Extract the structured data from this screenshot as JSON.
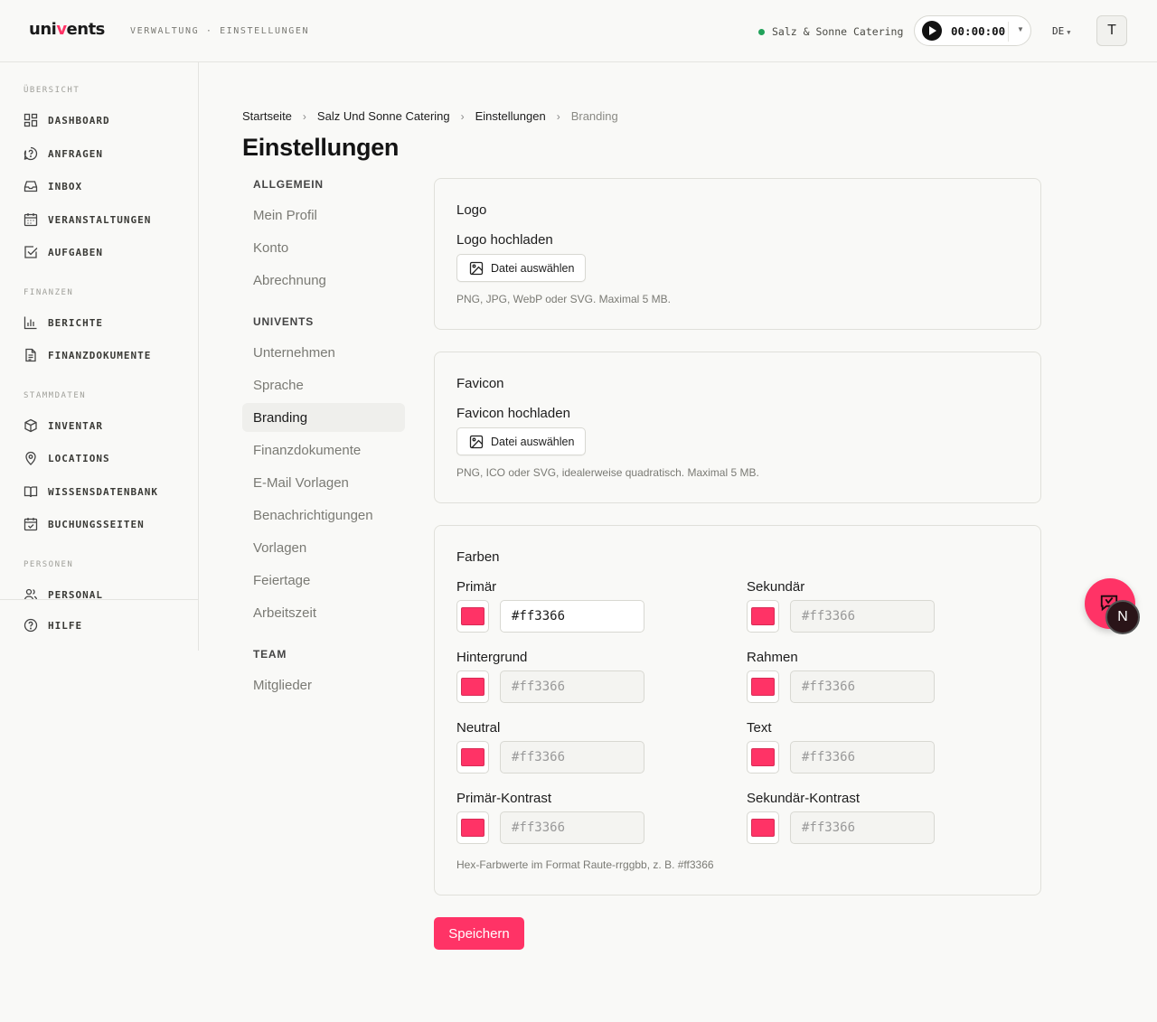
{
  "header": {
    "logo_text_pre": "uni",
    "logo_text_accent": "v",
    "logo_text_post": "ents",
    "breadcrumb": "VERWALTUNG · EINSTELLUNGEN",
    "company": "Salz & Sonne Catering",
    "timer": "00:00:00",
    "language": "DE",
    "avatar_initial": "T"
  },
  "sidebar": {
    "sections": [
      {
        "title": "ÜBERSICHT"
      },
      {
        "title": "FINANZEN"
      },
      {
        "title": "STAMMDATEN"
      },
      {
        "title": "PERSONEN"
      }
    ],
    "items": [
      {
        "label": "DASHBOARD",
        "icon": "dashboard-icon"
      },
      {
        "label": "ANFRAGEN",
        "icon": "question-icon"
      },
      {
        "label": "INBOX",
        "icon": "inbox-icon"
      },
      {
        "label": "VERANSTALTUNGEN",
        "icon": "calendar-icon"
      },
      {
        "label": "AUFGABEN",
        "icon": "checkbox-icon"
      },
      {
        "label": "BERICHTE",
        "icon": "chart-icon"
      },
      {
        "label": "FINANZDOKUMENTE",
        "icon": "document-icon"
      },
      {
        "label": "INVENTAR",
        "icon": "box-icon"
      },
      {
        "label": "LOCATIONS",
        "icon": "map-pin-icon"
      },
      {
        "label": "WISSENSDATENBANK",
        "icon": "book-icon"
      },
      {
        "label": "BUCHUNGSSEITEN",
        "icon": "calendar-check-icon"
      },
      {
        "label": "PERSONAL",
        "icon": "users-icon"
      },
      {
        "label": "HILFE",
        "icon": "help-icon"
      }
    ]
  },
  "breadcrumb": [
    "Startseite",
    "Salz Und Sonne Catering",
    "Einstellungen",
    "Branding"
  ],
  "page_title": "Einstellungen",
  "settings_nav": {
    "groups": [
      {
        "title": "ALLGEMEIN",
        "items": [
          "Mein Profil",
          "Konto",
          "Abrechnung"
        ]
      },
      {
        "title": "UNIVENTS",
        "items": [
          "Unternehmen",
          "Sprache",
          "Branding",
          "Finanzdokumente",
          "E-Mail Vorlagen",
          "Benachrichtigungen",
          "Vorlagen",
          "Feiertage",
          "Arbeitszeit"
        ]
      },
      {
        "title": "TEAM",
        "items": [
          "Mitglieder"
        ]
      }
    ],
    "active": "Branding"
  },
  "logo_card": {
    "title": "Logo",
    "label": "Logo hochladen",
    "button": "Datei auswählen",
    "hint": "PNG, JPG, WebP oder SVG. Maximal 5 MB."
  },
  "favicon_card": {
    "title": "Favicon",
    "label": "Favicon hochladen",
    "button": "Datei auswählen",
    "hint": "PNG, ICO oder SVG, idealerweise quadratisch. Maximal 5 MB."
  },
  "colors_card": {
    "title": "Farben",
    "fields": [
      {
        "label": "Primär",
        "value": "#ff3366",
        "filled": true
      },
      {
        "label": "Sekundär",
        "value": "#ff3366",
        "filled": false
      },
      {
        "label": "Hintergrund",
        "value": "#ff3366",
        "filled": false
      },
      {
        "label": "Rahmen",
        "value": "#ff3366",
        "filled": false
      },
      {
        "label": "Neutral",
        "value": "#ff3366",
        "filled": false
      },
      {
        "label": "Text",
        "value": "#ff3366",
        "filled": false
      },
      {
        "label": "Primär-Kontrast",
        "value": "#ff3366",
        "filled": false
      },
      {
        "label": "Sekundär-Kontrast",
        "value": "#ff3366",
        "filled": false
      }
    ],
    "hint": "Hex-Farbwerte im Format Raute-rrggbb, z. B. #ff3366"
  },
  "save_button": "Speichern",
  "floating": {
    "n_label": "N"
  },
  "colors": {
    "accent": "#ff3366",
    "status_online": "#22a25a"
  }
}
